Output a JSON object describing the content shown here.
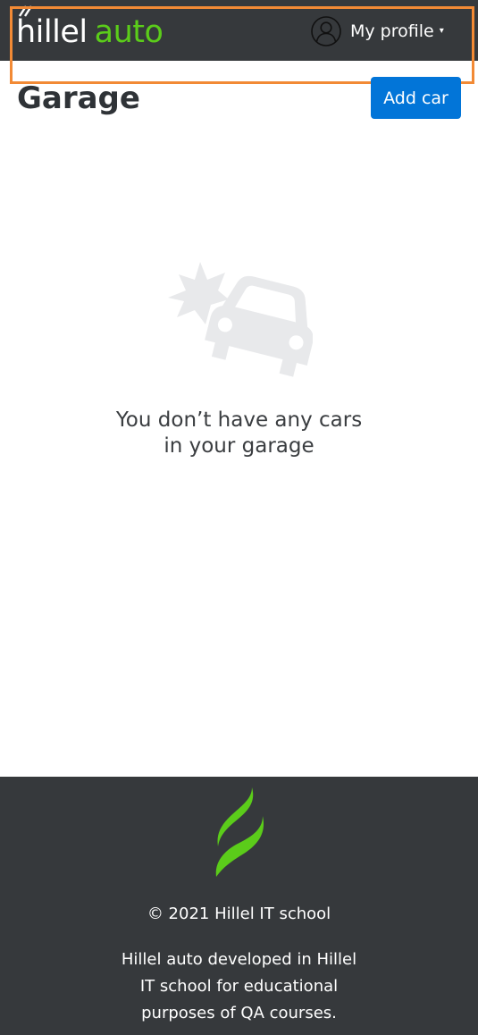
{
  "header": {
    "logo_primary": "hillel",
    "logo_accent": "auto",
    "profile_label": "My profile",
    "profile_icon": "user-circle-icon",
    "profile_caret_icon": "caret-down-icon"
  },
  "main": {
    "title": "Garage",
    "add_car_label": "Add car",
    "empty_icon": "car-crash-icon",
    "empty_message_line1": "You don’t have any cars",
    "empty_message_line2": "in your garage"
  },
  "footer": {
    "logo_icon": "hillel-leaf-logo",
    "copyright": "© 2021 Hillel IT school",
    "description_line1": "Hillel auto developed in Hillel",
    "description_line2": "IT school for educational",
    "description_line3": "purposes of QA courses."
  },
  "colors": {
    "header_bg": "#36393c",
    "accent_green": "#5bcc1a",
    "primary_button": "#0275d8",
    "highlight": "#f28a35",
    "empty_icon": "#e8e9eb"
  }
}
